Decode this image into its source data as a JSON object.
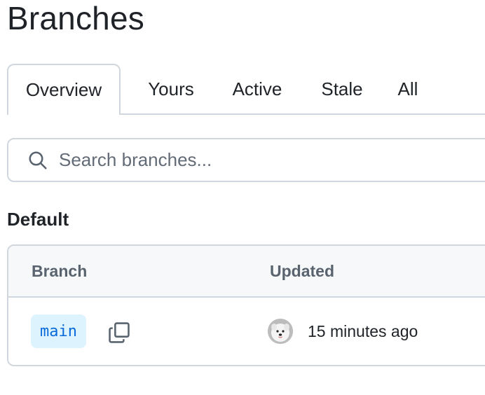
{
  "page": {
    "title": "Branches"
  },
  "tabs": [
    {
      "label": "Overview",
      "selected": true
    },
    {
      "label": "Yours",
      "selected": false
    },
    {
      "label": "Active",
      "selected": false
    },
    {
      "label": "Stale",
      "selected": false
    },
    {
      "label": "All",
      "selected": false
    }
  ],
  "search": {
    "placeholder": "Search branches...",
    "value": "",
    "icon": "search-icon"
  },
  "default_section": {
    "heading": "Default",
    "columns": {
      "branch": "Branch",
      "updated": "Updated"
    },
    "rows": [
      {
        "branch": "main",
        "copy_icon": "copy-icon",
        "avatar_icon": "user-avatar",
        "updated": "15 minutes ago"
      }
    ]
  },
  "colors": {
    "text": "#1f2328",
    "muted": "#59636e",
    "border": "#d0d7de",
    "header_bg": "#f6f8fa",
    "branch_bg": "#ddf4ff",
    "branch_text": "#0969da"
  }
}
